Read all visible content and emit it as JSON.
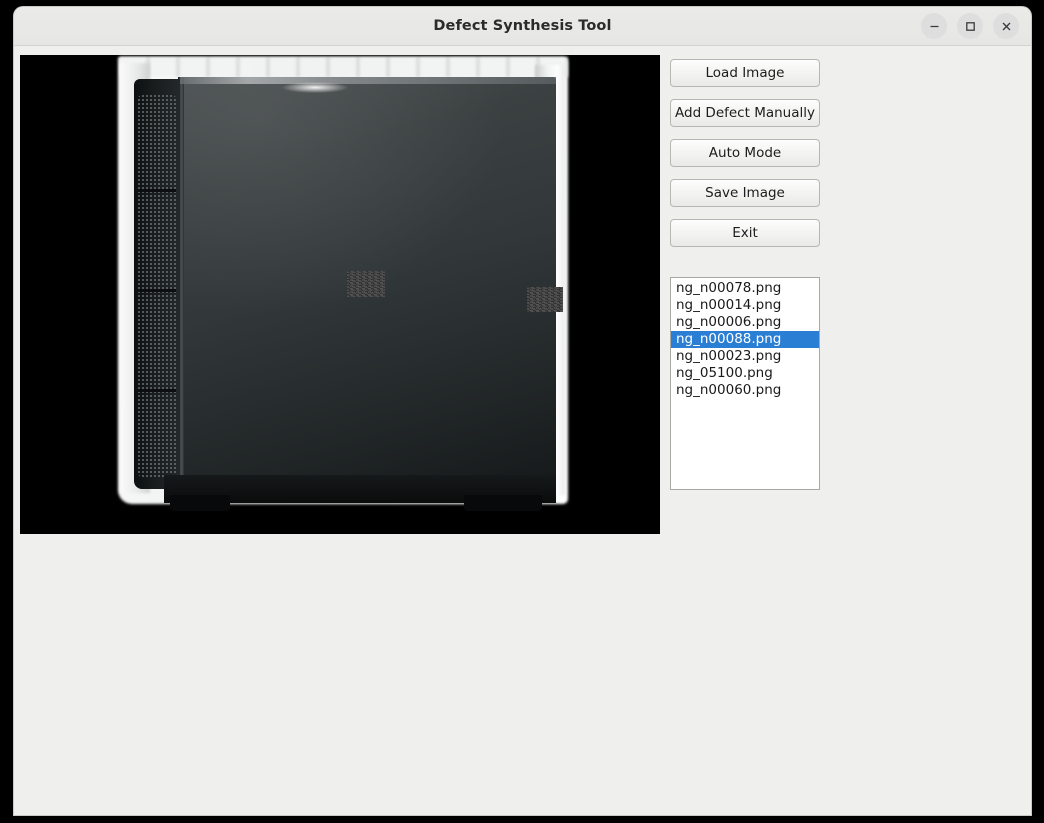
{
  "window": {
    "title": "Defect Synthesis Tool",
    "controls": [
      {
        "name": "minimize-button",
        "glyph": "minimize"
      },
      {
        "name": "maximize-button",
        "glyph": "maximize"
      },
      {
        "name": "close-button",
        "glyph": "close"
      }
    ]
  },
  "colors": {
    "selection": "#2a7fd4",
    "window_background": "#efefed",
    "titlebar": "#e8e8e6",
    "canvas_background": "#000000",
    "button_face": "#f3f3f1",
    "button_border": "#b6b6b2",
    "list_background": "#ffffff",
    "desktop": "#000000"
  },
  "buttons": [
    {
      "label": "Load Image",
      "name": "load-image-button"
    },
    {
      "label": "Add Defect Manually",
      "name": "add-defect-manually-button"
    },
    {
      "label": "Auto Mode",
      "name": "auto-mode-button"
    },
    {
      "label": "Save Image",
      "name": "save-image-button"
    },
    {
      "label": "Exit",
      "name": "exit-button"
    }
  ],
  "button_labels": {
    "load_image": "Load Image",
    "add_defect_manually": "Add Defect Manually",
    "auto_mode": "Auto Mode",
    "save_image": "Save Image",
    "exit": "Exit"
  },
  "file_list": {
    "selected_index": 3,
    "selected_value": "ng_n00088.png",
    "items": [
      "ng_n00078.png",
      "ng_n00014.png",
      "ng_n00006.png",
      "ng_n00088.png",
      "ng_n00023.png",
      "ng_05100.png",
      "ng_n00060.png"
    ]
  },
  "image_canvas": {
    "subject": "black computer tower case in white packaging",
    "defects": [
      {
        "name": "defect-patch-center",
        "kind": "noise-patch"
      },
      {
        "name": "defect-patch-right-edge",
        "kind": "noise-patch"
      }
    ]
  }
}
